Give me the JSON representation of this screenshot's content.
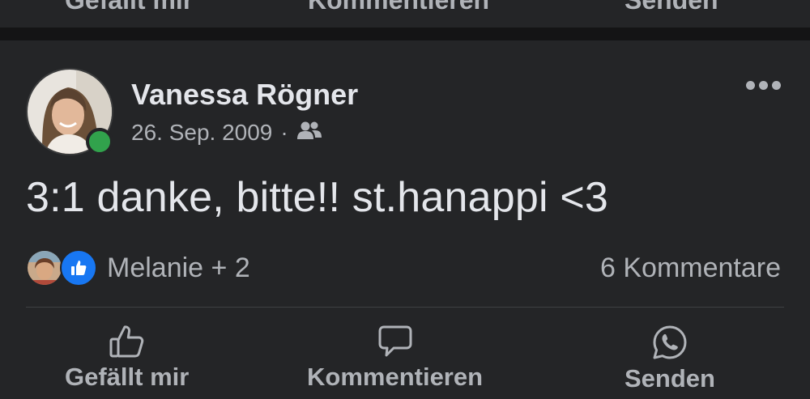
{
  "previous_post": {
    "actions": {
      "like": "Gefällt mir",
      "comment": "Kommentieren",
      "send": "Senden"
    }
  },
  "post": {
    "author": "Vanessa Rögner",
    "date": "26. Sep. 2009",
    "separator": "·",
    "audience_icon": "friends-icon",
    "online": true,
    "text": "3:1 danke, bitte!! st.hanappi <3",
    "reactions": {
      "names": "Melanie + 2",
      "icon": "like-icon"
    },
    "comments_count": "6 Kommentare",
    "actions": {
      "like": "Gefällt mir",
      "comment": "Kommentieren",
      "send": "Senden"
    }
  },
  "colors": {
    "background": "#242527",
    "text_primary": "#e4e6eb",
    "text_secondary": "#b0b3b8",
    "online": "#31a24c",
    "like_blue": "#1877f2"
  }
}
